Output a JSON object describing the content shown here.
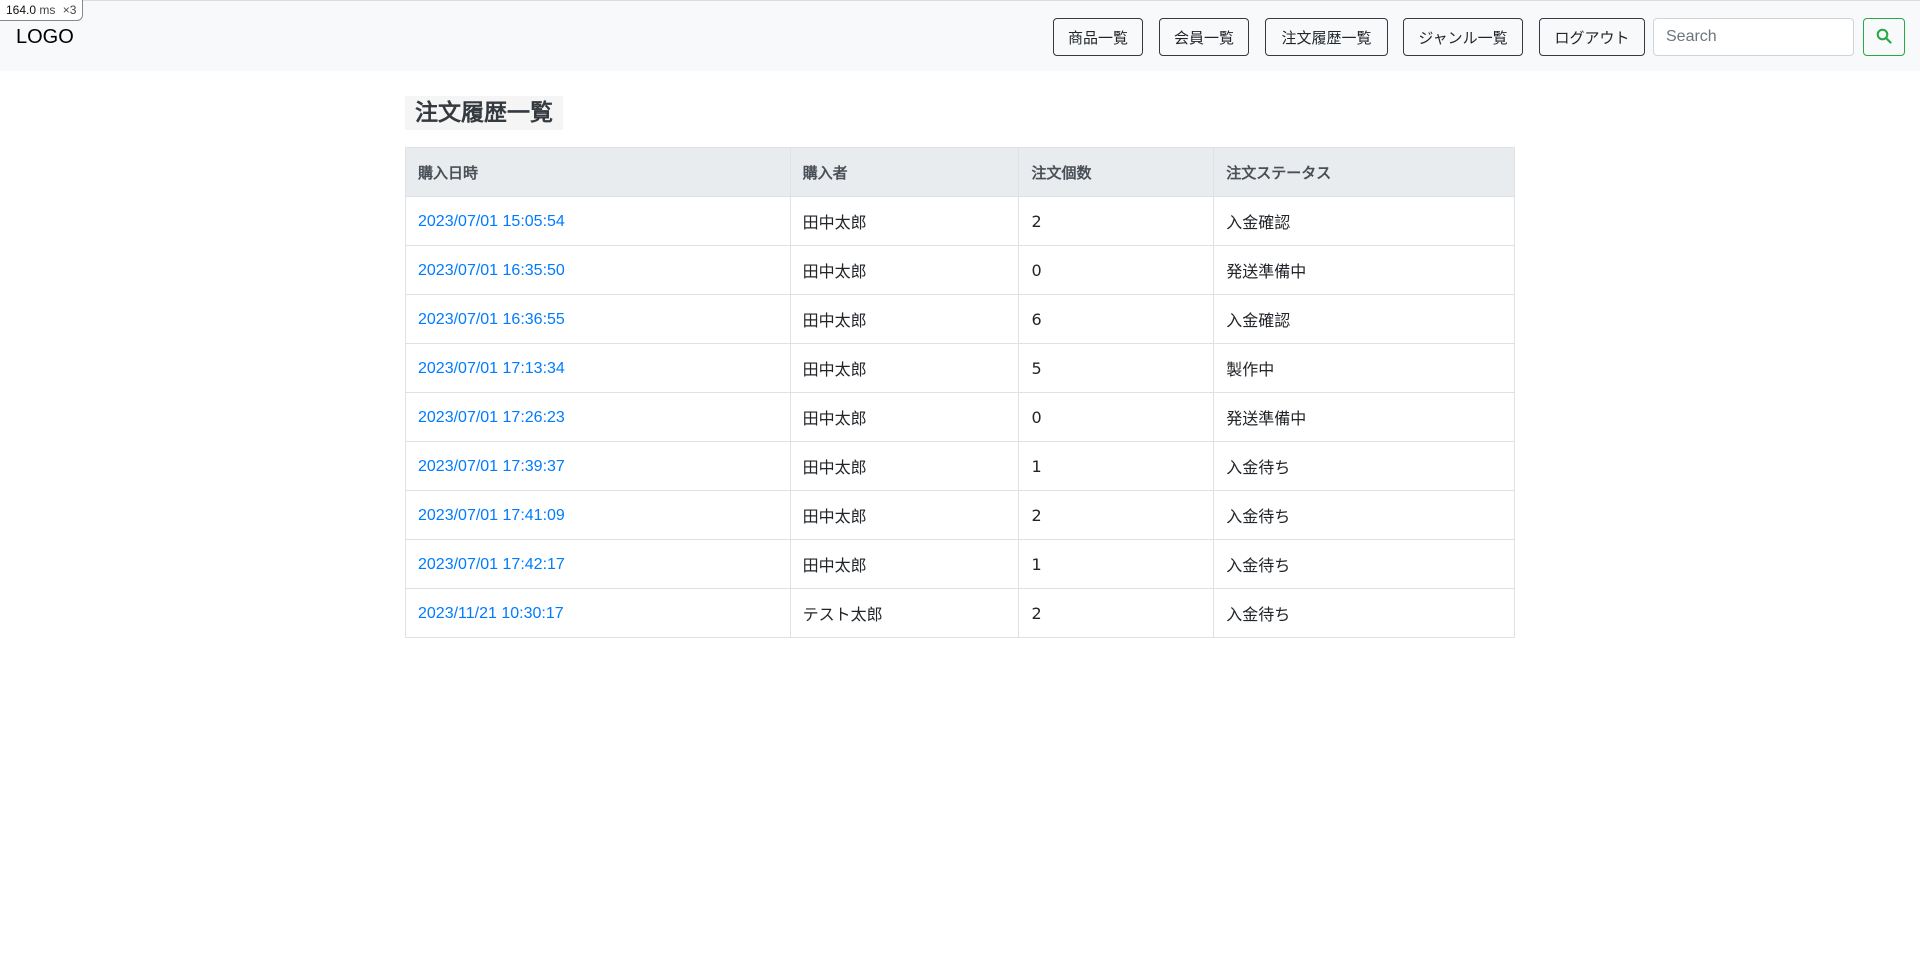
{
  "perf_badge": {
    "ms_value": "164.0",
    "ms_unit": "ms",
    "multiplier": "×3"
  },
  "navbar": {
    "logo": "LOGO",
    "links": [
      {
        "label": "商品一覧"
      },
      {
        "label": "会員一覧"
      },
      {
        "label": "注文履歴一覧"
      },
      {
        "label": "ジャンル一覧"
      },
      {
        "label": "ログアウト"
      }
    ],
    "search": {
      "placeholder": "Search",
      "value": "",
      "button_icon": "search-icon"
    }
  },
  "main": {
    "title": "注文履歴一覧",
    "table": {
      "headers": [
        "購入日時",
        "購入者",
        "注文個数",
        "注文ステータス"
      ],
      "rows": [
        {
          "date": "2023/07/01 15:05:54",
          "buyer": "田中太郎",
          "quantity": "2",
          "status": "入金確認"
        },
        {
          "date": "2023/07/01 16:35:50",
          "buyer": "田中太郎",
          "quantity": "0",
          "status": "発送準備中"
        },
        {
          "date": "2023/07/01 16:36:55",
          "buyer": "田中太郎",
          "quantity": "6",
          "status": "入金確認"
        },
        {
          "date": "2023/07/01 17:13:34",
          "buyer": "田中太郎",
          "quantity": "5",
          "status": "製作中"
        },
        {
          "date": "2023/07/01 17:26:23",
          "buyer": "田中太郎",
          "quantity": "0",
          "status": "発送準備中"
        },
        {
          "date": "2023/07/01 17:39:37",
          "buyer": "田中太郎",
          "quantity": "1",
          "status": "入金待ち"
        },
        {
          "date": "2023/07/01 17:41:09",
          "buyer": "田中太郎",
          "quantity": "2",
          "status": "入金待ち"
        },
        {
          "date": "2023/07/01 17:42:17",
          "buyer": "田中太郎",
          "quantity": "1",
          "status": "入金待ち"
        },
        {
          "date": "2023/11/21 10:30:17",
          "buyer": "テスト太郎",
          "quantity": "2",
          "status": "入金待ち"
        }
      ]
    }
  },
  "colors": {
    "link": "#007bff",
    "navbar_bg": "#f8f9fa",
    "header_bg": "#e9ecef",
    "search_button": "#28a745"
  }
}
